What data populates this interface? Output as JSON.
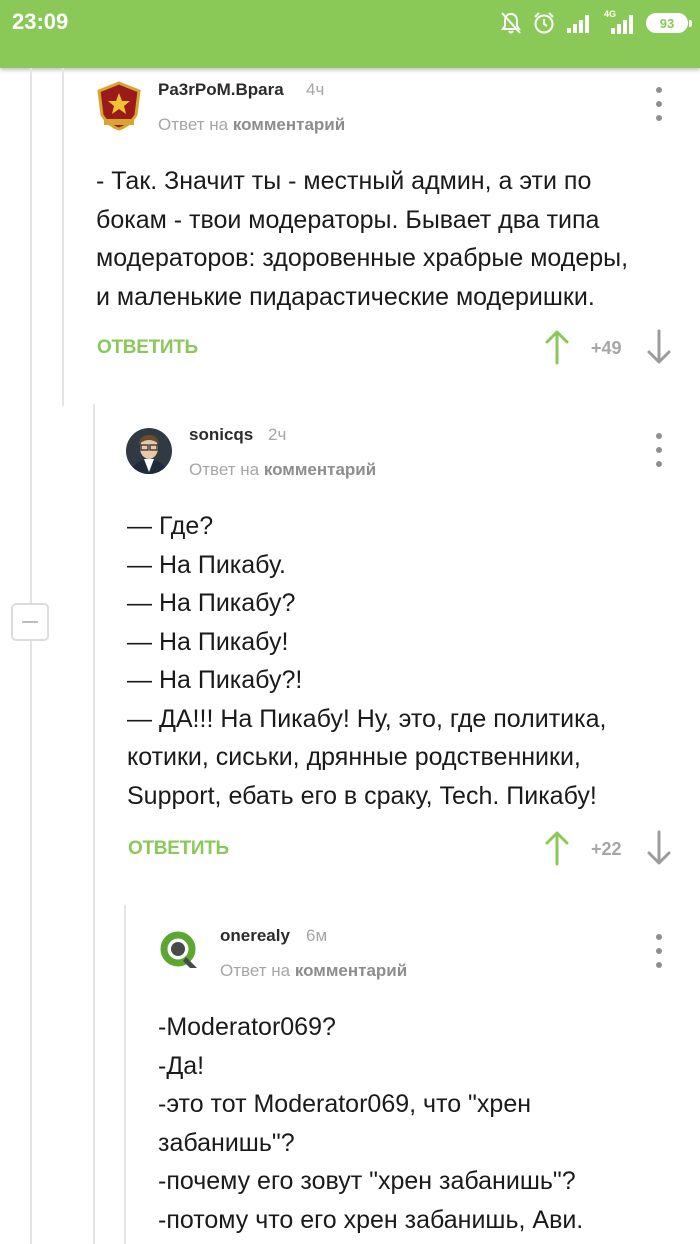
{
  "status_bar": {
    "time": "23:09",
    "network_label": "4G",
    "battery": "93",
    "icons": [
      "mute-bell-icon",
      "alarm-icon",
      "signal-icon",
      "signal-4g-icon",
      "battery-icon"
    ]
  },
  "colors": {
    "accent": "#8ac858",
    "muted": "#a6a6a6",
    "text": "#1a1a1a"
  },
  "comments": [
    {
      "author": "Pa3rPoM.Bpara",
      "time": "4ч",
      "reply_prefix": "Ответ на",
      "reply_link": "комментарий",
      "lines": [
        "- Так. Значит ты - местный админ, а эти по",
        "бокам - твои модераторы. Бывает два типа",
        "модераторов: здоровенные храбрые модеры,",
        "и маленькие пидарастические модеришки."
      ],
      "reply_label": "ОТВЕТИТЬ",
      "score": "+49"
    },
    {
      "author": "sonicqs",
      "time": "2ч",
      "reply_prefix": "Ответ на",
      "reply_link": "комментарий",
      "lines": [
        "— Где?",
        "— На Пикабу.",
        "— На Пикабу?",
        "— На Пикабу!",
        "— На Пикабу?!",
        "— ДА!!! На Пикабу! Ну, это, где политика,",
        "котики, сиськи, дрянные родственники,",
        "Support, ебать его в сраку, Tech. Пикабу!"
      ],
      "reply_label": "ОТВЕТИТЬ",
      "score": "+22"
    },
    {
      "author": "onerealy",
      "time": "6м",
      "reply_prefix": "Ответ на",
      "reply_link": "комментарий",
      "lines": [
        "-Moderator069?",
        "-Да!",
        "-это тот Moderator069, что \"хрен",
        "забанишь\"?",
        "-почему его зовут \"хрен забанишь\"?",
        "-потому что его хрен забанишь, Ави."
      ]
    }
  ]
}
